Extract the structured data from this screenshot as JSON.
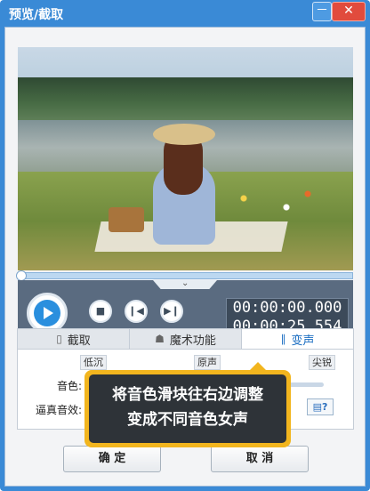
{
  "window": {
    "title": "预览/截取",
    "min_label": "－",
    "close_label": "✕"
  },
  "video": {
    "duration_shown": "00:00:25.554"
  },
  "controls": {
    "chevron": "⌄",
    "buttons": [
      "stop-icon",
      "prev-icon",
      "next-icon"
    ],
    "stop_glyph": "■",
    "prev_glyph": "❙◀",
    "next_glyph": "▶❙",
    "time_current": "00:00:00.000",
    "time_total": "00:00:25.554",
    "volume_fraction": 1.0
  },
  "tabs": [
    {
      "label": "截取",
      "icon": "crop-icon",
      "glyph": "▯"
    },
    {
      "label": "魔术功能",
      "icon": "magic-icon",
      "glyph": "☗"
    },
    {
      "label": "变声",
      "icon": "voice-icon",
      "glyph": "∥"
    }
  ],
  "voice": {
    "ticks": [
      "低沉",
      "原声",
      "尖锐"
    ],
    "tone_label": "音色:",
    "tone_fraction": 0.78,
    "real_label": "逼真音效:",
    "help_label": "▤?"
  },
  "footer": {
    "ok_label": "确 定",
    "cancel_label": "取 消"
  },
  "tooltip": {
    "line1": "将音色滑块往右边调整",
    "line2": "变成不同音色女声"
  },
  "colors": {
    "title_bar": "#3a8ad6",
    "accent": "#2e86dc",
    "close": "#e14b3d",
    "tooltip_border": "#f2b51e",
    "tooltip_bg": "#2e3338"
  }
}
